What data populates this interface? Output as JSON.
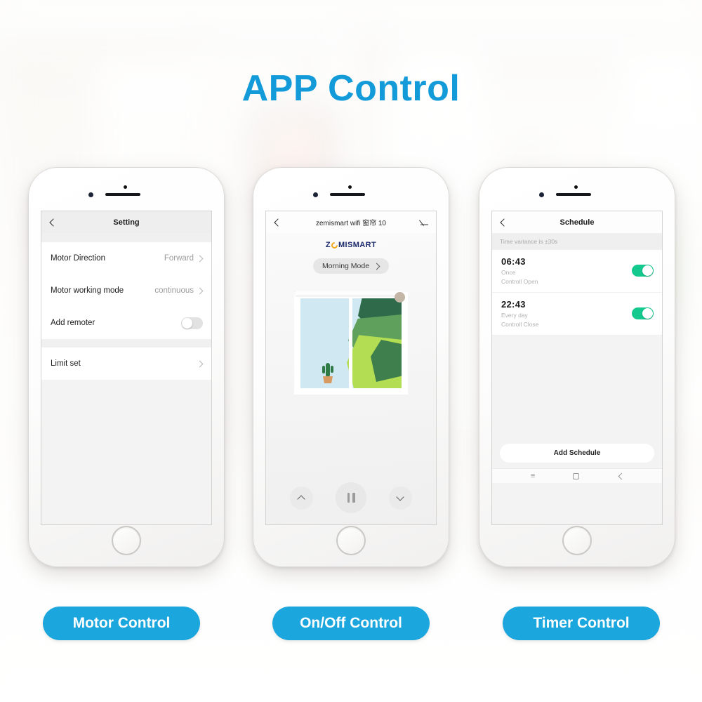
{
  "headline": "APP Control",
  "theme": {
    "accent_blue": "#1ba6dd",
    "headline_blue": "#129bd8",
    "toggle_green": "#13c98d",
    "brand_navy": "#1b2a6b",
    "brand_orange": "#f2a81d"
  },
  "phone1": {
    "appbar": {
      "title": "Setting",
      "back_icon": "chevron-left-icon"
    },
    "rows": [
      {
        "label": "Motor Direction",
        "value": "Forward",
        "type": "chevron"
      },
      {
        "label": "Motor working mode",
        "value": "continuous",
        "type": "chevron"
      },
      {
        "label": "Add remoter",
        "value": "",
        "type": "toggle",
        "state": "off"
      }
    ],
    "rows2": [
      {
        "label": "Limit set",
        "value": "",
        "type": "chevron"
      }
    ]
  },
  "phone2": {
    "appbar": {
      "title": "zemismart wifi 窗帘 10",
      "back_icon": "chevron-left-icon",
      "edit_icon": "pencil-icon"
    },
    "brand": {
      "prefix": "Z",
      "mark": "e-logo-mark",
      "suffix": "MISMART"
    },
    "mode_pill": {
      "label": "Morning Mode",
      "chevron": "chevron-right-icon"
    },
    "illustration": "window-with-curtain-and-cactus",
    "controls": [
      {
        "name": "open",
        "icon": "chevron-up-icon"
      },
      {
        "name": "pause",
        "icon": "pause-icon"
      },
      {
        "name": "close",
        "icon": "chevron-down-icon"
      }
    ]
  },
  "phone3": {
    "appbar": {
      "title": "Schedule",
      "back_icon": "chevron-left-icon"
    },
    "note": "Time variance is ±30s",
    "items": [
      {
        "time": "06:43",
        "repeat": "Once",
        "action": "Controll Open",
        "state": "on"
      },
      {
        "time": "22:43",
        "repeat": "Every day",
        "action": "Controll Close",
        "state": "on"
      }
    ],
    "add_button": "Add Schedule",
    "navbar": [
      {
        "name": "menu-icon",
        "glyph": "≡"
      },
      {
        "name": "home-square-icon",
        "glyph": ""
      },
      {
        "name": "back-icon",
        "glyph": ""
      }
    ]
  },
  "captions": [
    {
      "label": "Motor Control"
    },
    {
      "label": "On/Off Control"
    },
    {
      "label": "Timer Control"
    }
  ]
}
